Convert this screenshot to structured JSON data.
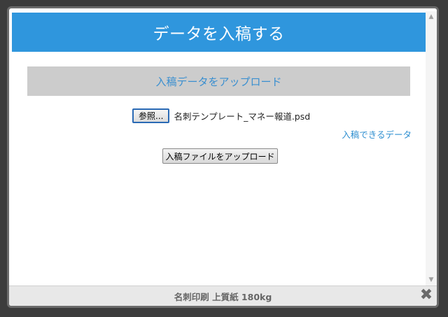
{
  "dialog": {
    "title": "データを入稿する",
    "section_title": "入稿データをアップロード",
    "browse_label": "参照...",
    "file_name": "名刺テンプレート_マネー報道.psd",
    "allowed_link": "入稿できるデータ",
    "submit_label": "入稿ファイルをアップロード",
    "footer_text": "名刺印刷 上質紙 180kg",
    "close_glyph": "✖"
  },
  "icons": {
    "scroll_up": "▲",
    "scroll_down": "▼"
  },
  "colors": {
    "header": "#2f96dd",
    "accent_text": "#3a8fd0"
  }
}
